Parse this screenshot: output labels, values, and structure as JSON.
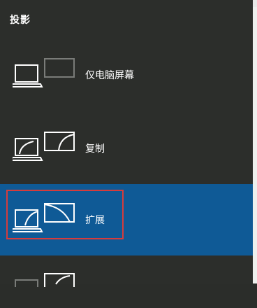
{
  "panel": {
    "title": "投影",
    "options": [
      {
        "label": "仅电脑屏幕",
        "icon": "pc-screen-only-icon",
        "selected": false
      },
      {
        "label": "复制",
        "icon": "duplicate-icon",
        "selected": false
      },
      {
        "label": "扩展",
        "icon": "extend-icon",
        "selected": true
      },
      {
        "label": "",
        "icon": "second-screen-only-icon",
        "selected": false
      }
    ]
  },
  "colors": {
    "background": "#2c2e2b",
    "selected": "#0f5a96",
    "highlight_border": "#d63c3c"
  }
}
